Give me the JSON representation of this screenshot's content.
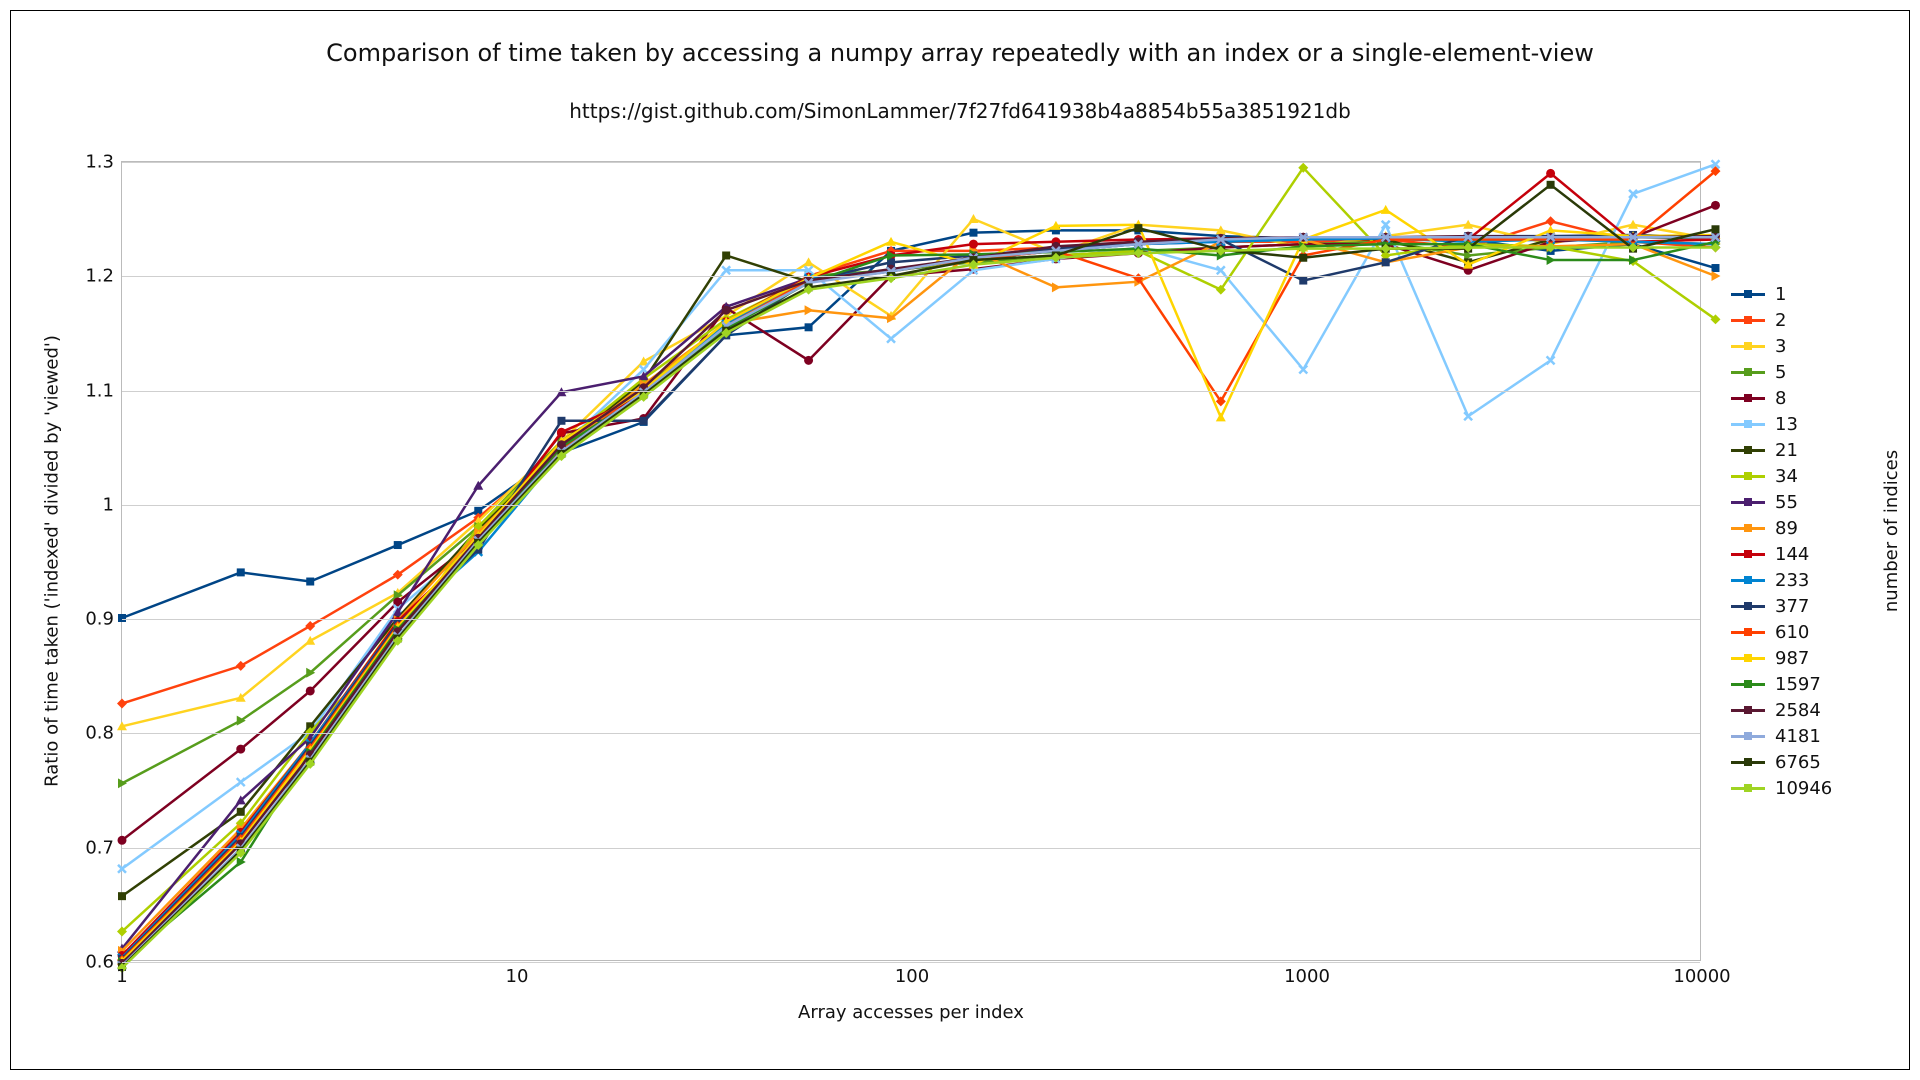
{
  "chart_data": {
    "type": "line",
    "title": "Comparison of time taken by accessing a numpy array repeatedly with an index or a single-element-view",
    "subtitle": "https://gist.github.com/SimonLammer/7f27fd641938b4a8854b55a3851921db",
    "xlabel": "Array accesses per index",
    "ylabel": "Ratio of time taken ('indexed' divided by 'viewed')",
    "legend_title": "number of indices",
    "x_scale": "log",
    "x_ticks": [
      1,
      10,
      100,
      1000,
      10000
    ],
    "y_ticks": [
      0.6,
      0.7,
      0.8,
      0.9,
      1.0,
      1.1,
      1.2,
      1.3
    ],
    "xlim": [
      1,
      10000
    ],
    "ylim": [
      0.6,
      1.3
    ],
    "x": [
      1,
      2,
      3,
      5,
      8,
      13,
      21,
      34,
      55,
      89,
      144,
      233,
      377,
      610,
      987,
      1597,
      2584,
      4181,
      6765,
      10946
    ],
    "series": [
      {
        "name": "1",
        "color": "#004586",
        "values": [
          0.9,
          0.94,
          0.932,
          0.964,
          0.994,
          1.045,
          1.072,
          1.148,
          1.155,
          1.222,
          1.238,
          1.24,
          1.24,
          1.235,
          1.233,
          1.232,
          1.232,
          1.222,
          1.228,
          1.207
        ]
      },
      {
        "name": "2",
        "color": "#ff420e",
        "values": [
          0.825,
          0.858,
          0.893,
          0.938,
          0.988,
          1.05,
          1.1,
          1.16,
          1.2,
          1.222,
          1.222,
          1.225,
          1.23,
          1.23,
          1.23,
          1.232,
          1.225,
          1.248,
          1.23,
          1.225
        ]
      },
      {
        "name": "3",
        "color": "#ffd320",
        "values": [
          0.805,
          0.83,
          0.88,
          0.922,
          0.985,
          1.055,
          1.125,
          1.165,
          1.212,
          1.165,
          1.25,
          1.22,
          1.245,
          1.24,
          1.225,
          1.235,
          1.245,
          1.228,
          1.245,
          1.232
        ]
      },
      {
        "name": "5",
        "color": "#579d1c",
        "values": [
          0.755,
          0.81,
          0.852,
          0.92,
          0.98,
          1.055,
          1.104,
          1.152,
          1.2,
          1.205,
          1.212,
          1.218,
          1.222,
          1.225,
          1.228,
          1.23,
          1.218,
          1.225,
          1.23,
          1.228
        ]
      },
      {
        "name": "8",
        "color": "#7e0021",
        "values": [
          0.705,
          0.785,
          0.836,
          0.914,
          0.97,
          1.062,
          1.075,
          1.172,
          1.126,
          1.2,
          1.206,
          1.215,
          1.22,
          1.225,
          1.228,
          1.228,
          1.205,
          1.23,
          1.234,
          1.262
        ]
      },
      {
        "name": "13",
        "color": "#83caff",
        "values": [
          0.68,
          0.756,
          0.8,
          0.908,
          0.968,
          1.05,
          1.118,
          1.205,
          1.205,
          1.145,
          1.205,
          1.215,
          1.225,
          1.205,
          1.118,
          1.245,
          1.077,
          1.126,
          1.272,
          1.298
        ]
      },
      {
        "name": "21",
        "color": "#314004",
        "values": [
          0.656,
          0.73,
          0.805,
          0.9,
          0.978,
          1.05,
          1.108,
          1.218,
          1.195,
          1.204,
          1.215,
          1.225,
          1.23,
          1.232,
          1.233,
          1.232,
          1.212,
          1.232,
          1.234,
          1.233
        ]
      },
      {
        "name": "34",
        "color": "#aecf00",
        "values": [
          0.625,
          0.72,
          0.8,
          0.882,
          0.98,
          1.052,
          1.11,
          1.162,
          1.198,
          1.205,
          1.214,
          1.218,
          1.222,
          1.188,
          1.295,
          1.218,
          1.228,
          1.226,
          1.213,
          1.162
        ]
      },
      {
        "name": "55",
        "color": "#4b1f6f",
        "values": [
          0.61,
          0.74,
          0.795,
          0.905,
          1.016,
          1.098,
          1.112,
          1.173,
          1.198,
          1.205,
          1.215,
          1.222,
          1.228,
          1.23,
          1.232,
          1.233,
          1.233,
          1.234,
          1.234,
          1.234
        ]
      },
      {
        "name": "89",
        "color": "#ff950e",
        "values": [
          0.608,
          0.715,
          0.79,
          0.898,
          0.975,
          1.048,
          1.105,
          1.158,
          1.17,
          1.163,
          1.222,
          1.19,
          1.195,
          1.23,
          1.232,
          1.212,
          1.225,
          1.226,
          1.228,
          1.2
        ]
      },
      {
        "name": "144",
        "color": "#c5000b",
        "values": [
          0.604,
          0.712,
          0.79,
          0.897,
          0.965,
          1.063,
          1.095,
          1.16,
          1.199,
          1.218,
          1.228,
          1.23,
          1.232,
          1.233,
          1.234,
          1.233,
          1.232,
          1.29,
          1.23,
          1.232
        ]
      },
      {
        "name": "233",
        "color": "#0084d1",
        "values": [
          0.602,
          0.71,
          0.79,
          0.895,
          0.958,
          1.045,
          1.098,
          1.158,
          1.198,
          1.205,
          1.215,
          1.222,
          1.228,
          1.23,
          1.232,
          1.233,
          1.23,
          1.232,
          1.23,
          1.228
        ]
      },
      {
        "name": "377",
        "color": "#1f3a6b",
        "values": [
          0.601,
          0.708,
          0.788,
          0.895,
          0.96,
          1.073,
          1.073,
          1.148,
          1.196,
          1.212,
          1.218,
          1.224,
          1.23,
          1.232,
          1.196,
          1.212,
          1.235,
          1.235,
          1.236,
          1.234
        ]
      },
      {
        "name": "610",
        "color": "#ff4000",
        "values": [
          0.6,
          0.706,
          0.786,
          0.893,
          0.97,
          1.048,
          1.096,
          1.156,
          1.196,
          1.205,
          1.215,
          1.222,
          1.198,
          1.09,
          1.218,
          1.232,
          1.232,
          1.232,
          1.232,
          1.292
        ]
      },
      {
        "name": "987",
        "color": "#ffd500",
        "values": [
          0.599,
          0.704,
          0.784,
          0.892,
          0.972,
          1.055,
          1.1,
          1.16,
          1.198,
          1.23,
          1.21,
          1.244,
          1.245,
          1.076,
          1.232,
          1.258,
          1.21,
          1.24,
          1.235,
          1.236
        ]
      },
      {
        "name": "1597",
        "color": "#2b8b1a",
        "values": [
          0.598,
          0.686,
          0.782,
          0.89,
          0.968,
          1.05,
          1.096,
          1.154,
          1.194,
          1.218,
          1.219,
          1.221,
          1.224,
          1.218,
          1.226,
          1.228,
          1.228,
          1.214,
          1.214,
          1.23
        ]
      },
      {
        "name": "2584",
        "color": "#5a1832",
        "values": [
          0.597,
          0.702,
          0.78,
          0.888,
          0.97,
          1.052,
          1.102,
          1.17,
          1.196,
          1.206,
          1.216,
          1.226,
          1.23,
          1.233,
          1.234,
          1.234,
          1.235,
          1.234,
          1.234,
          1.235
        ]
      },
      {
        "name": "4181",
        "color": "#8faadc",
        "values": [
          0.595,
          0.698,
          0.776,
          0.884,
          0.968,
          1.046,
          1.098,
          1.156,
          1.194,
          1.204,
          1.216,
          1.222,
          1.228,
          1.232,
          1.234,
          1.234,
          1.234,
          1.234,
          1.234,
          1.234
        ]
      },
      {
        "name": "6765",
        "color": "#2a3a08",
        "values": [
          0.594,
          0.696,
          0.774,
          0.882,
          0.966,
          1.044,
          1.096,
          1.152,
          1.19,
          1.2,
          1.214,
          1.218,
          1.242,
          1.223,
          1.216,
          1.224,
          1.224,
          1.28,
          1.224,
          1.241
        ]
      },
      {
        "name": "10946",
        "color": "#9fd423",
        "values": [
          0.593,
          0.694,
          0.772,
          0.88,
          0.964,
          1.042,
          1.094,
          1.15,
          1.188,
          1.198,
          1.21,
          1.216,
          1.22,
          1.222,
          1.224,
          1.224,
          1.225,
          1.225,
          1.225,
          1.225
        ]
      }
    ]
  }
}
